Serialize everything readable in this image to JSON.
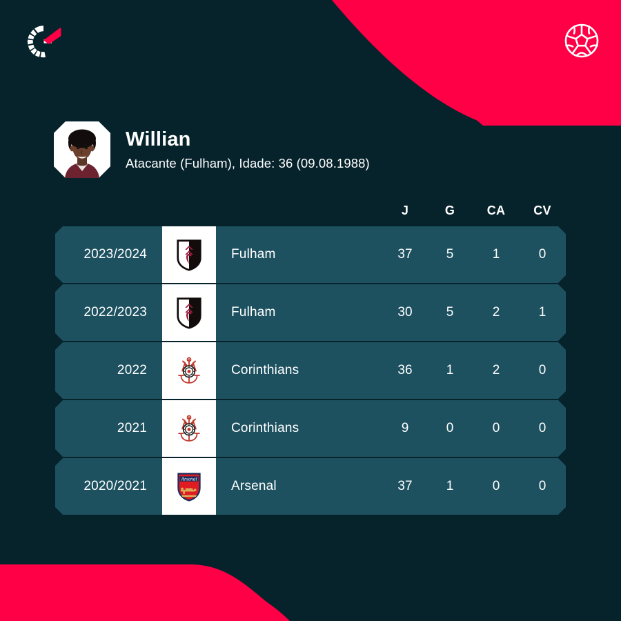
{
  "theme": {
    "background": "#06222b",
    "accent_red": "#ff0046",
    "row_background": "#1d5160",
    "text": "#ffffff",
    "crest_panel": "#ffffff"
  },
  "header": {
    "logo_name": "flashscore-logo",
    "ball_icon_name": "soccer-ball-icon"
  },
  "player": {
    "name": "Willian",
    "meta": "Atacante (Fulham), Idade: 36 (09.08.1988)",
    "position": "Atacante",
    "club": "Fulham",
    "age_label": "Idade",
    "age": "36",
    "birthdate": "09.08.1988",
    "avatar_name": "player-photo"
  },
  "table": {
    "columns": [
      {
        "key": "season",
        "label": ""
      },
      {
        "key": "crest",
        "label": ""
      },
      {
        "key": "team",
        "label": ""
      },
      {
        "key": "j",
        "label": "J"
      },
      {
        "key": "g",
        "label": "G"
      },
      {
        "key": "ca",
        "label": "CA"
      },
      {
        "key": "cv",
        "label": "CV"
      }
    ],
    "headers": {
      "j": "J",
      "g": "G",
      "ca": "CA",
      "cv": "CV"
    },
    "rows": [
      {
        "season": "2023/2024",
        "team": "Fulham",
        "crest": "fulham",
        "j": "37",
        "g": "5",
        "ca": "1",
        "cv": "0"
      },
      {
        "season": "2022/2023",
        "team": "Fulham",
        "crest": "fulham",
        "j": "30",
        "g": "5",
        "ca": "2",
        "cv": "1"
      },
      {
        "season": "2022",
        "team": "Corinthians",
        "crest": "corinthians",
        "j": "36",
        "g": "1",
        "ca": "2",
        "cv": "0"
      },
      {
        "season": "2021",
        "team": "Corinthians",
        "crest": "corinthians",
        "j": "9",
        "g": "0",
        "ca": "0",
        "cv": "0"
      },
      {
        "season": "2020/2021",
        "team": "Arsenal",
        "crest": "arsenal",
        "j": "37",
        "g": "1",
        "ca": "0",
        "cv": "0"
      }
    ]
  }
}
